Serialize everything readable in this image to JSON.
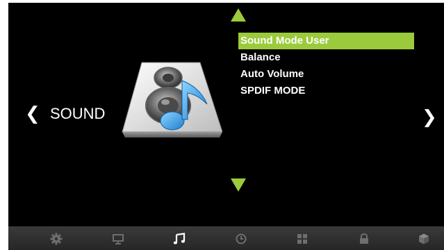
{
  "category": {
    "title": "SOUND"
  },
  "menu": {
    "items": [
      {
        "label": "Sound Mode User"
      },
      {
        "label": "Balance"
      },
      {
        "label": "Auto Volume"
      },
      {
        "label": "SPDIF MODE"
      }
    ],
    "selected_index": 0
  },
  "navigation": {
    "prev_glyph": "❮",
    "next_glyph": "❯",
    "tabs": [
      {
        "icon": "gear-icon"
      },
      {
        "icon": "monitor-icon"
      },
      {
        "icon": "music-note-icon",
        "active": true
      },
      {
        "icon": "clock-icon"
      },
      {
        "icon": "grid-icon"
      },
      {
        "icon": "lock-icon"
      },
      {
        "icon": "cube-icon"
      }
    ]
  },
  "colors": {
    "accent": "#9bcb3c",
    "background": "#000000",
    "text": "#ffffff",
    "bar": "#2e2e2e",
    "inactive_icon": "#6e6e6e"
  }
}
